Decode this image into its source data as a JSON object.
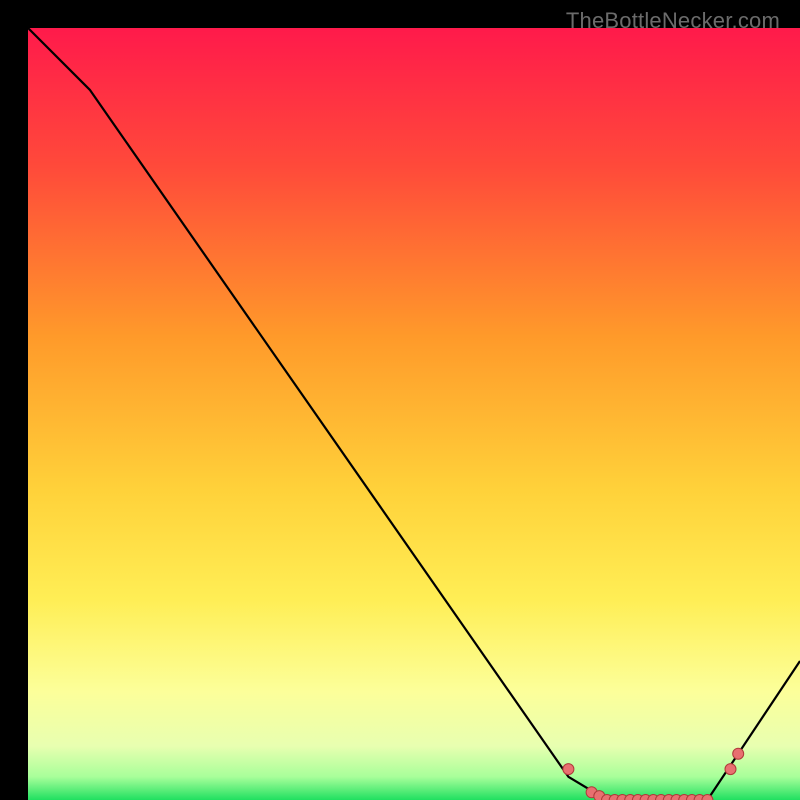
{
  "attribution": "TheBottleNecker.com",
  "colors": {
    "gradient_top": "#ff1a4b",
    "gradient_upper_mid": "#ff8a2a",
    "gradient_mid": "#ffe03a",
    "gradient_lower": "#fbff9a",
    "gradient_bottom": "#20e060",
    "curve": "#000000",
    "marker_fill": "#e87070",
    "marker_stroke": "#b03a3a"
  },
  "chart_data": {
    "type": "line",
    "title": "",
    "xlabel": "",
    "ylabel": "",
    "xlim": [
      0,
      100
    ],
    "ylim": [
      0,
      100
    ],
    "series": [
      {
        "name": "curve",
        "x": [
          0,
          8,
          70,
          75,
          88,
          100
        ],
        "y": [
          100,
          92,
          3,
          0,
          0,
          18
        ]
      }
    ],
    "markers": {
      "x": [
        70,
        73,
        74,
        75,
        76,
        77,
        78,
        79,
        80,
        81,
        82,
        83,
        84,
        85,
        86,
        87,
        88,
        91,
        92
      ],
      "y": [
        4,
        1,
        0.5,
        0,
        0,
        0,
        0,
        0,
        0,
        0,
        0,
        0,
        0,
        0,
        0,
        0,
        0,
        4,
        6
      ]
    }
  }
}
